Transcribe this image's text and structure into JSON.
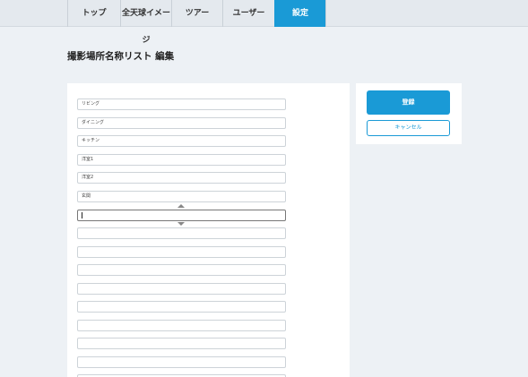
{
  "nav": {
    "tabs": [
      {
        "label": "トップ"
      },
      {
        "label": "全天球イメージ"
      },
      {
        "label": "ツアー"
      },
      {
        "label": "ユーザー"
      },
      {
        "label": "設定"
      }
    ],
    "active_index": 4
  },
  "page": {
    "title": "撮影場所名称リスト 編集"
  },
  "locations": [
    {
      "value": "リビング"
    },
    {
      "value": "ダイニング"
    },
    {
      "value": "キッチン"
    },
    {
      "value": "洋室1"
    },
    {
      "value": "洋室2"
    },
    {
      "value": "玄関"
    },
    {
      "value": ""
    },
    {
      "value": ""
    },
    {
      "value": ""
    },
    {
      "value": ""
    },
    {
      "value": ""
    },
    {
      "value": ""
    },
    {
      "value": ""
    },
    {
      "value": ""
    },
    {
      "value": ""
    },
    {
      "value": ""
    }
  ],
  "actions": {
    "register_label": "登録",
    "cancel_label": "キャンセル"
  },
  "colors": {
    "accent": "#1a9ad6",
    "background": "#edf1f5"
  },
  "icons": {
    "move_up": "triangle-up-icon",
    "move_down": "triangle-down-icon"
  }
}
